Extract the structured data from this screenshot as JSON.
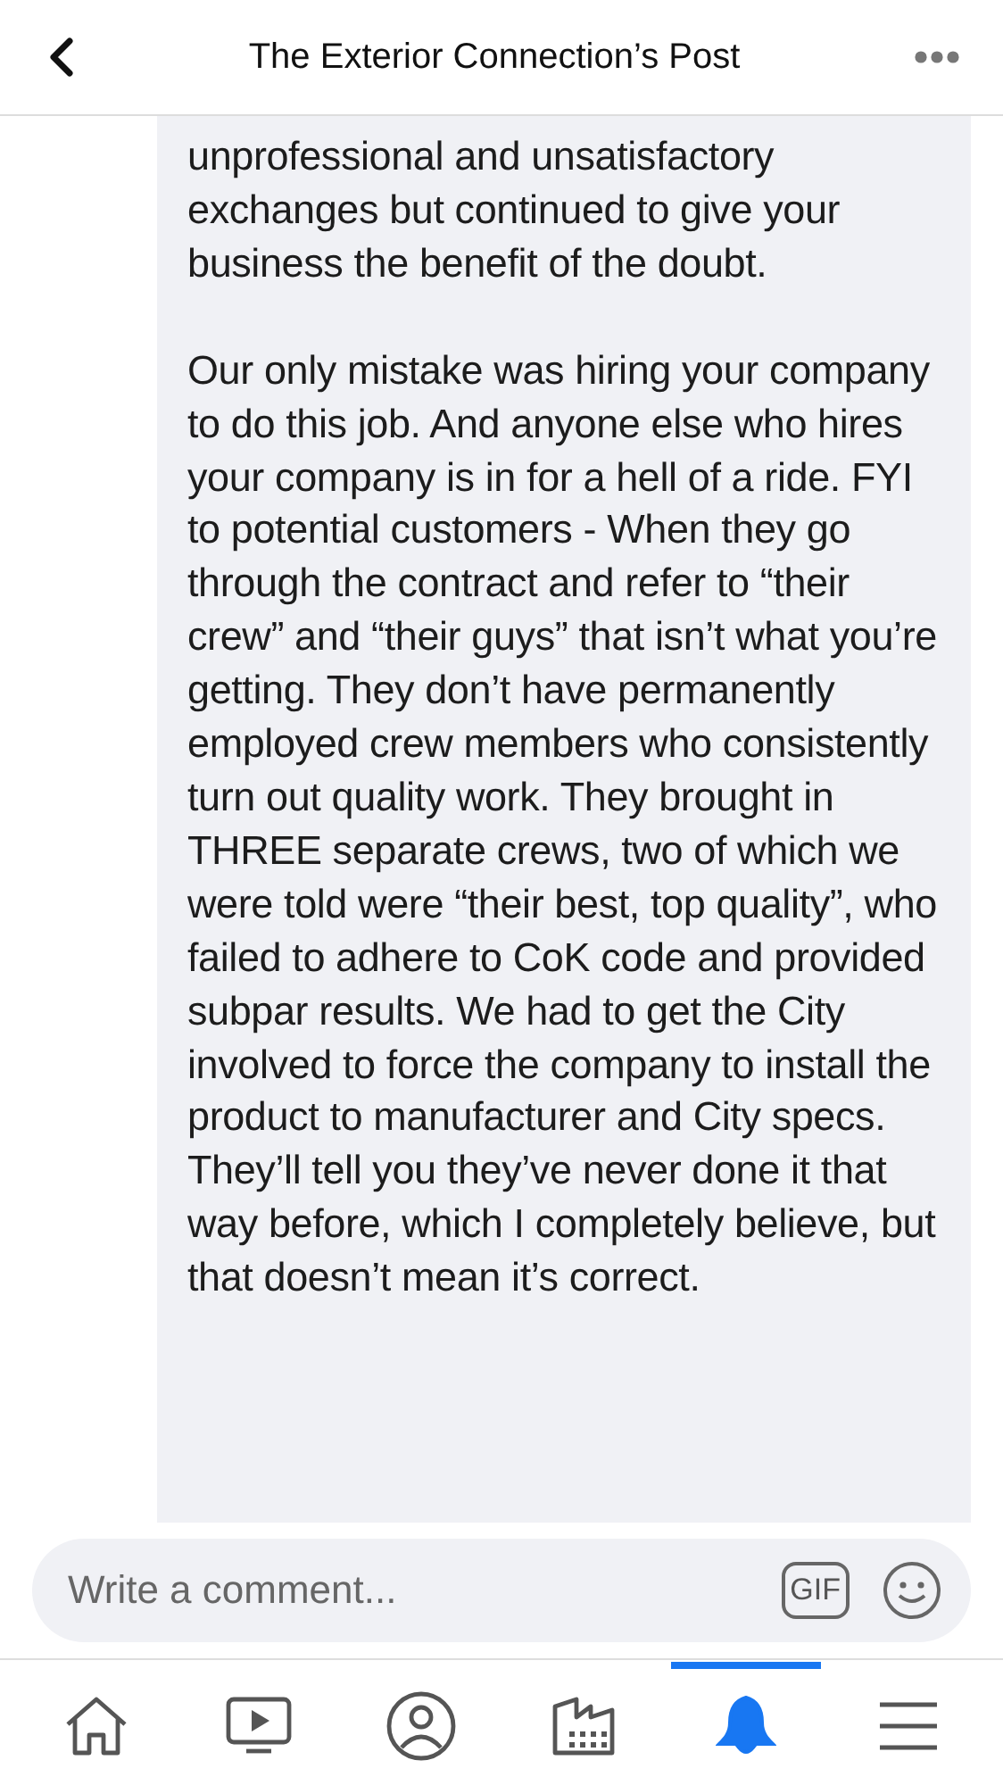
{
  "header": {
    "title": "The Exterior Connection’s Post"
  },
  "comment_paragraphs": [
    "unprofessional and unsatisfactory exchanges but continued to give your business the benefit of the doubt.",
    "Our only mistake was hiring your company to do this job. And anyone else who hires your company is in for a hell of a ride. FYI to potential customers - When they go through the contract and refer to “their crew” and “their guys” that isn’t what you’re getting. They don’t have permanently employed crew members who consistently turn out quality work. They brought in THREE separate crews, two of which we were told were “their best, top quality”, who failed to adhere to CoK code and provided subpar results. We had to get the City involved to force the company to install the product to manufacturer and City specs. They’ll tell you they’ve never done it that way before, which I completely believe, but that doesn’t mean it’s correct."
  ],
  "comment_box": {
    "placeholder": "Write a comment...",
    "gif": "GIF"
  },
  "tabs": [
    {
      "kind": "home",
      "selected": false
    },
    {
      "kind": "video",
      "selected": false
    },
    {
      "kind": "profile",
      "selected": false
    },
    {
      "kind": "pages",
      "selected": false
    },
    {
      "kind": "notifications",
      "selected": true
    },
    {
      "kind": "menu",
      "selected": false
    }
  ]
}
